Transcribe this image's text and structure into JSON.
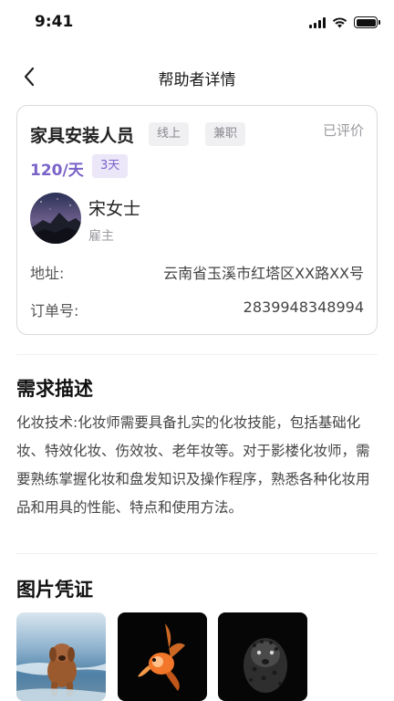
{
  "status_bar": {
    "time": "9:41"
  },
  "nav": {
    "title": "帮助者详情"
  },
  "job": {
    "title": "家具安装人员",
    "tags": [
      "线上",
      "兼职"
    ],
    "review_status": "已评价",
    "price": "120/天",
    "duration": "3天"
  },
  "employer": {
    "name": "宋女士",
    "role": "雇主"
  },
  "details": {
    "address_label": "地址:",
    "address_value": "云南省玉溪市红塔区XX路XX号",
    "order_label": "订单号:",
    "order_value": "2839948348994"
  },
  "description": {
    "title": "需求描述",
    "text": "化妆技术:化妆师需要具备扎实的化妆技能，包括基础化妆、特效化妆、伤效妆、老年妆等。对于影楼化妆师，需要熟练掌握化妆和盘发知识及操作程序，熟悉各种化妆用品和用具的性能、特点和使用方法。"
  },
  "photos": {
    "title": "图片凭证",
    "items": [
      "dog-photo",
      "goldfish-photo",
      "leopard-photo"
    ]
  },
  "colors": {
    "accent": "#7a63c8",
    "accent_bg": "#ebe6f8"
  }
}
